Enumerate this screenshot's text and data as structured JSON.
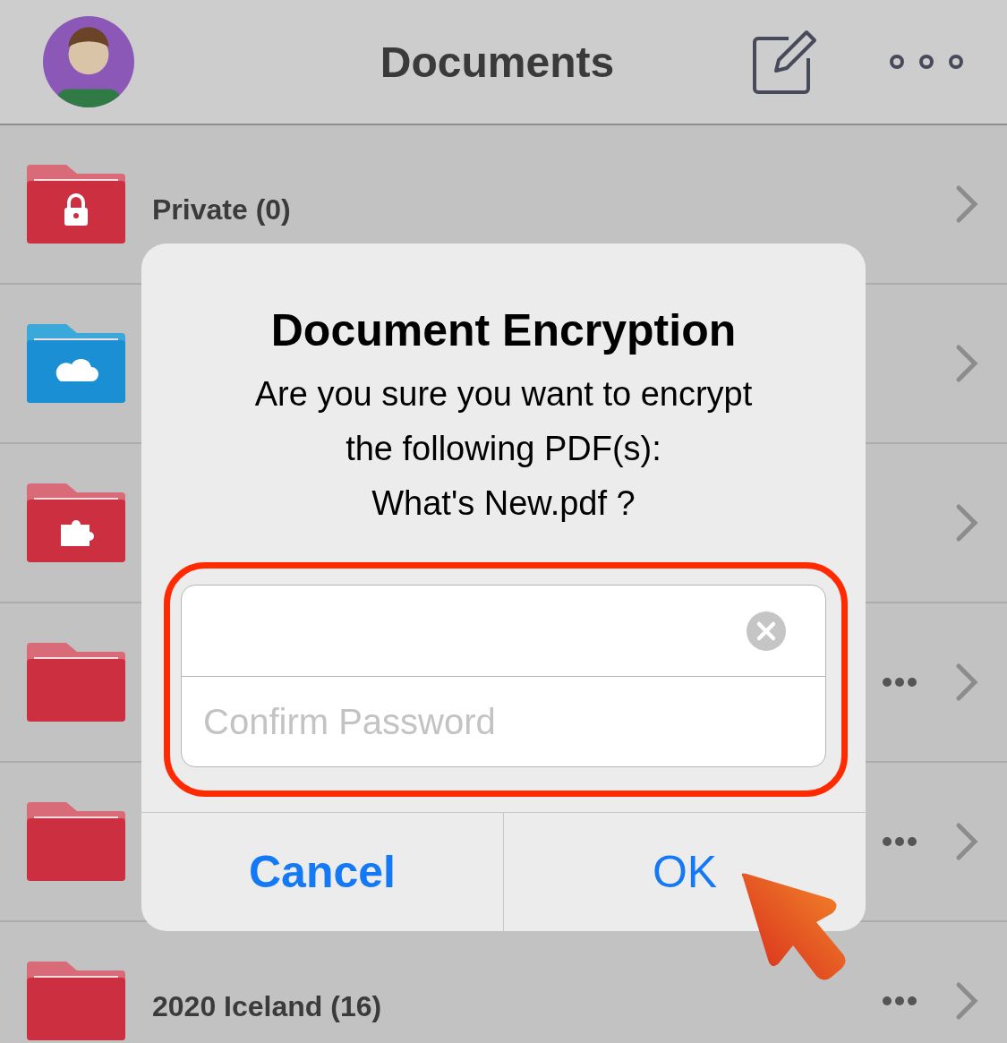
{
  "header": {
    "title": "Documents"
  },
  "folders": [
    {
      "name": "Private (0)",
      "kind": "lock",
      "more": false
    },
    {
      "kind": "cloud",
      "more": false
    },
    {
      "kind": "plugin",
      "more": false
    },
    {
      "kind": "plain",
      "more": true
    },
    {
      "kind": "plain",
      "more": true
    },
    {
      "name": "2020 Iceland (16)",
      "kind": "plain",
      "more": true
    }
  ],
  "dialog": {
    "title": "Document Encryption",
    "message": "Are you sure you want to encrypt\nthe following PDF(s):\nWhat's New.pdf ?",
    "password_field": {
      "clear_button": true
    },
    "confirm_field": {
      "placeholder": "Confirm Password"
    },
    "buttons": [
      {
        "label": "Cancel",
        "preferred": true
      },
      {
        "label": "OK",
        "preferred": false
      }
    ]
  }
}
